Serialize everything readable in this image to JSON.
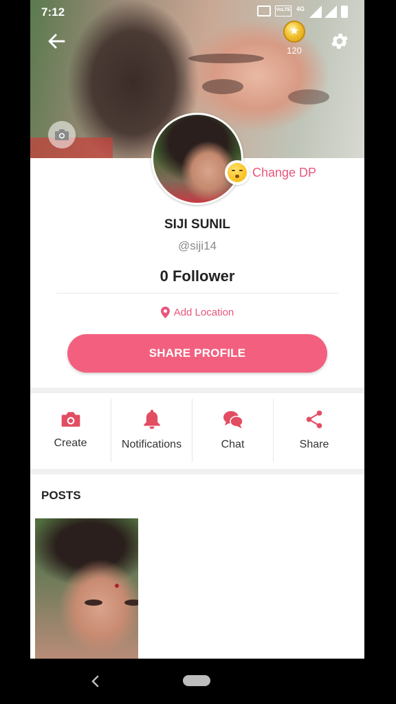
{
  "status_bar": {
    "time": "7:12",
    "network": "4G",
    "volte": "VoLTE"
  },
  "header": {
    "coins": "120"
  },
  "profile": {
    "name": "SIJI SUNIL",
    "handle": "@siji14",
    "followers": "0 Follower",
    "change_dp_label": "Change DP",
    "add_location_label": "Add Location",
    "share_profile_label": "SHARE PROFILE"
  },
  "actions": [
    {
      "label": "Create",
      "icon": "camera-icon"
    },
    {
      "label": "Notifications",
      "icon": "bell-icon"
    },
    {
      "label": "Chat",
      "icon": "chat-bubbles-icon"
    },
    {
      "label": "Share",
      "icon": "share-icon"
    }
  ],
  "posts": {
    "heading": "POSTS"
  },
  "colors": {
    "accent": "#f3607f",
    "accent_text": "#e8567c",
    "icon_red": "#e24d62"
  }
}
